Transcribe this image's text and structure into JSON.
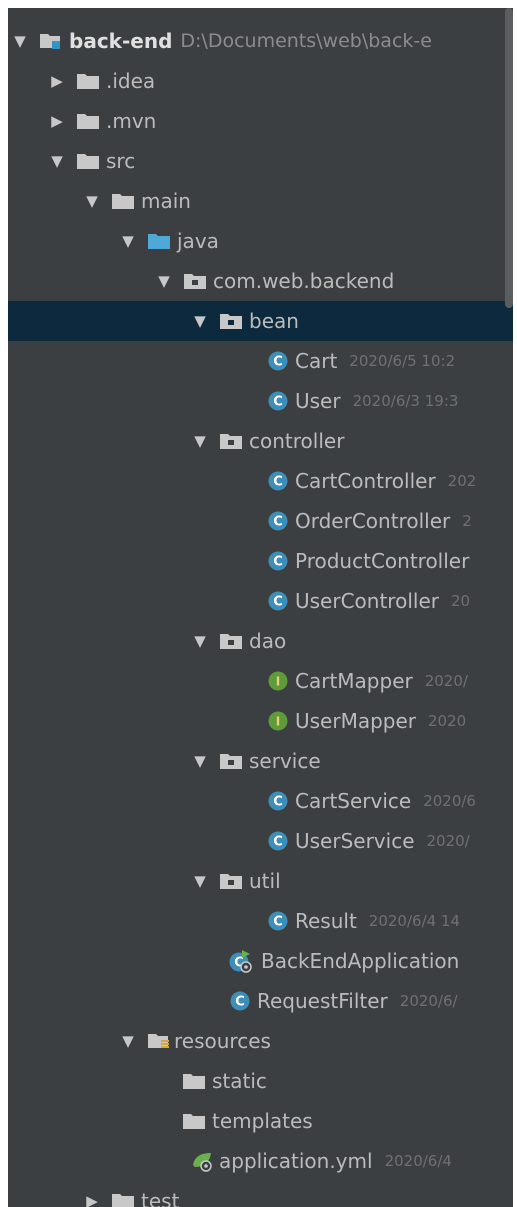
{
  "colors": {
    "panel_bg": "#3c3f41",
    "selection": "#0d293e",
    "folder": "#c8c8c8",
    "source_folder": "#4fa8d8",
    "class_icon": "#3d8eb9",
    "interface_icon": "#5e9c3a",
    "resources_mark": "#d6a93a"
  },
  "tree": {
    "root": {
      "label": "back-end",
      "path": "D:\\Documents\\web\\back-e"
    },
    "idea": {
      "label": ".idea"
    },
    "mvn": {
      "label": ".mvn"
    },
    "src": {
      "label": "src"
    },
    "main": {
      "label": "main"
    },
    "java": {
      "label": "java"
    },
    "package": {
      "label": "com.web.backend"
    },
    "bean": {
      "label": "bean"
    },
    "cart": {
      "label": "Cart",
      "meta": "2020/6/5 10:2"
    },
    "user": {
      "label": "User",
      "meta": "2020/6/3 19:3"
    },
    "controller": {
      "label": "controller"
    },
    "cart_controller": {
      "label": "CartController",
      "meta": "202"
    },
    "order_controller": {
      "label": "OrderController",
      "meta": "2"
    },
    "product_controller": {
      "label": "ProductController",
      "meta": ""
    },
    "user_controller": {
      "label": "UserController",
      "meta": "20"
    },
    "dao": {
      "label": "dao"
    },
    "cart_mapper": {
      "label": "CartMapper",
      "meta": "2020/"
    },
    "user_mapper": {
      "label": "UserMapper",
      "meta": "2020"
    },
    "service": {
      "label": "service"
    },
    "cart_service": {
      "label": "CartService",
      "meta": "2020/6"
    },
    "user_service": {
      "label": "UserService",
      "meta": "2020/"
    },
    "util": {
      "label": "util"
    },
    "result": {
      "label": "Result",
      "meta": "2020/6/4 14"
    },
    "backend_app": {
      "label": "BackEndApplication",
      "meta": ""
    },
    "request_filter": {
      "label": "RequestFilter",
      "meta": "2020/6/"
    },
    "resources": {
      "label": "resources"
    },
    "static": {
      "label": "static"
    },
    "templates": {
      "label": "templates"
    },
    "application_yml": {
      "label": "application.yml",
      "meta": "2020/6/4"
    },
    "test": {
      "label": "test"
    }
  },
  "icons": {
    "expand": "triangle-down",
    "collapse": "triangle-right",
    "folder": "folder-icon",
    "class": "class-c-icon",
    "interface": "interface-i-icon",
    "spring": "spring-boot-icon"
  }
}
